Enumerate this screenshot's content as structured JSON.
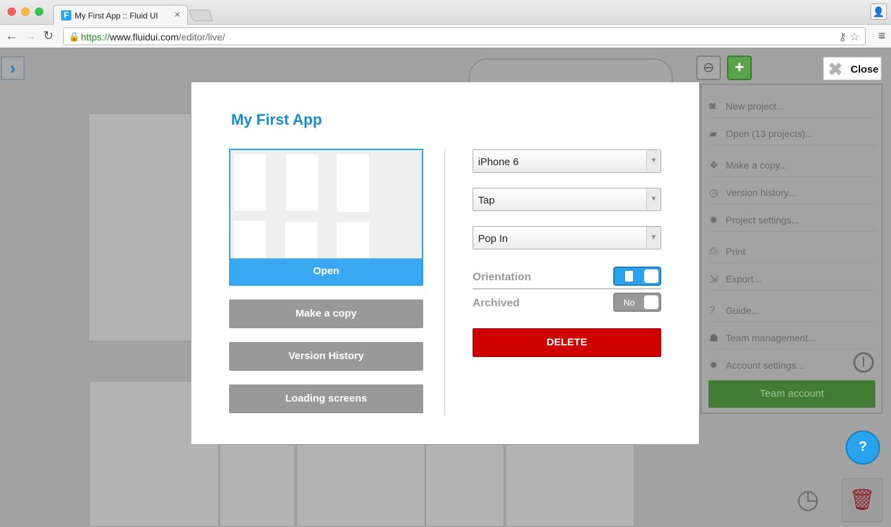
{
  "browser": {
    "tab_title": "My First App :: Fluid UI",
    "tab_favicon": "F",
    "url_scheme": "https://",
    "url_host": "www.fluidui.com",
    "url_path": "/editor/live/"
  },
  "editor": {
    "close_label": "Close",
    "menu_items": [
      {
        "icon": "camera-icon",
        "glyph": "◙",
        "label": "New project..."
      },
      {
        "icon": "folder-icon",
        "glyph": "▰",
        "label": "Open (13 projects)..."
      },
      {
        "icon": "copy-icon",
        "glyph": "❖",
        "label": "Make a copy..."
      },
      {
        "icon": "history-icon",
        "glyph": "◷",
        "label": "Version history..."
      },
      {
        "icon": "gear-icon",
        "glyph": "✹",
        "label": "Project settings..."
      },
      {
        "icon": "print-icon",
        "glyph": "⎙",
        "label": "Print"
      },
      {
        "icon": "export-icon",
        "glyph": "⇲",
        "label": "Export..."
      },
      {
        "icon": "question-icon",
        "glyph": "?",
        "label": "Guide..."
      },
      {
        "icon": "team-icon",
        "glyph": "☗",
        "label": "Team management..."
      },
      {
        "icon": "gear-icon",
        "glyph": "✹",
        "label": "Account settings..."
      }
    ],
    "team_account_label": "Team account",
    "help_glyph": "?"
  },
  "modal": {
    "title": "My First App",
    "thumb_open_label": "Open",
    "buttons": {
      "copy": "Make a copy",
      "history": "Version History",
      "loading": "Loading screens"
    },
    "device": "iPhone 6",
    "gesture": "Tap",
    "transition": "Pop In",
    "orientation_label": "Orientation",
    "archived_label": "Archived",
    "archived_value": "No",
    "delete_label": "DELETE"
  },
  "colors": {
    "accent_blue": "#2aa3ee",
    "title_blue": "#1a8ad1",
    "delete_red": "#d10000"
  }
}
